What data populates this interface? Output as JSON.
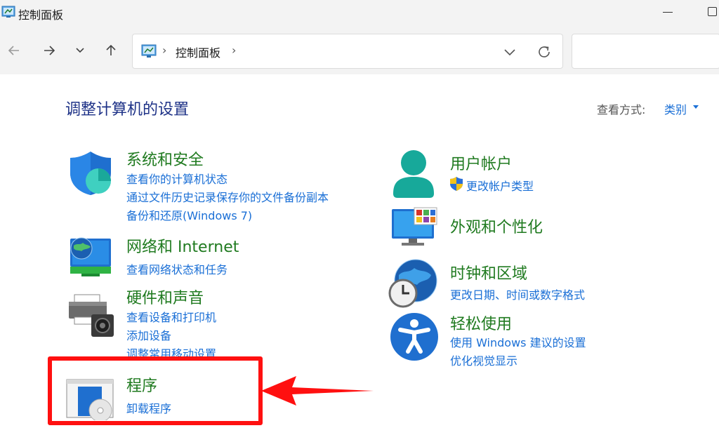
{
  "window": {
    "title": "控制面板"
  },
  "nav": {
    "breadcrumb": "控制面板"
  },
  "page": {
    "title": "调整计算机的设置",
    "view_by_label": "查看方式:",
    "view_by_value": "类别"
  },
  "categories": {
    "security": {
      "title": "系统和安全",
      "links": [
        "查看你的计算机状态",
        "通过文件历史记录保存你的文件备份副本",
        "备份和还原(Windows 7)"
      ]
    },
    "network": {
      "title": "网络和 Internet",
      "links": [
        "查看网络状态和任务"
      ]
    },
    "hardware": {
      "title": "硬件和声音",
      "links": [
        "查看设备和打印机",
        "添加设备",
        "调整常用移动设置"
      ]
    },
    "programs": {
      "title": "程序",
      "links": [
        "卸载程序"
      ]
    },
    "accounts": {
      "title": "用户帐户",
      "links": [
        "更改帐户类型"
      ]
    },
    "appearance": {
      "title": "外观和个性化",
      "links": []
    },
    "clock": {
      "title": "时钟和区域",
      "links": [
        "更改日期、时间或数字格式"
      ]
    },
    "ease": {
      "title": "轻松使用",
      "links": [
        "使用 Windows 建议的设置",
        "优化视觉显示"
      ]
    }
  },
  "colors": {
    "category_title": "#1f7a1f",
    "link": "#1a6fd6",
    "page_title": "#1e3287",
    "highlight": "#ff1010"
  }
}
